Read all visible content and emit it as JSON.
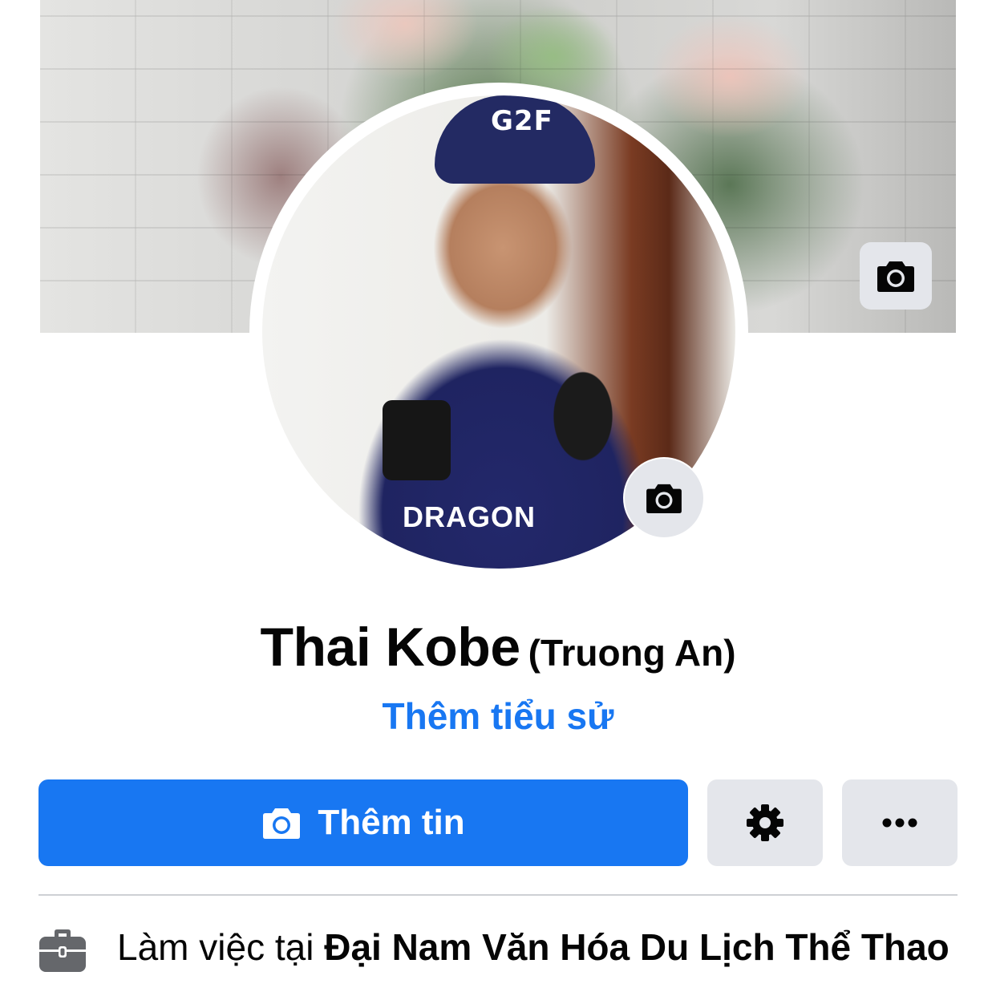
{
  "profile": {
    "name": "Thai Kobe",
    "alternate_name": "(Truong An)",
    "bio_link": "Thêm tiểu sử"
  },
  "cover": {
    "camera_icon": "camera-icon"
  },
  "avatar": {
    "cap_text": "G2F",
    "shirt_text": "DRAGON",
    "camera_icon": "camera-icon"
  },
  "actions": {
    "add_story_label": "Thêm tin",
    "add_story_icon": "camera-icon",
    "settings_icon": "gear-icon",
    "more_icon": "more-dots-icon"
  },
  "intro": {
    "work_prefix": "Làm việc tại ",
    "work_place": "Đại Nam Văn Hóa Du Lịch Thể Thao",
    "work_icon": "briefcase-icon"
  },
  "colors": {
    "accent": "#1877f2",
    "button_gray": "#e4e6eb",
    "text": "#050505",
    "divider": "#ced0d4"
  }
}
